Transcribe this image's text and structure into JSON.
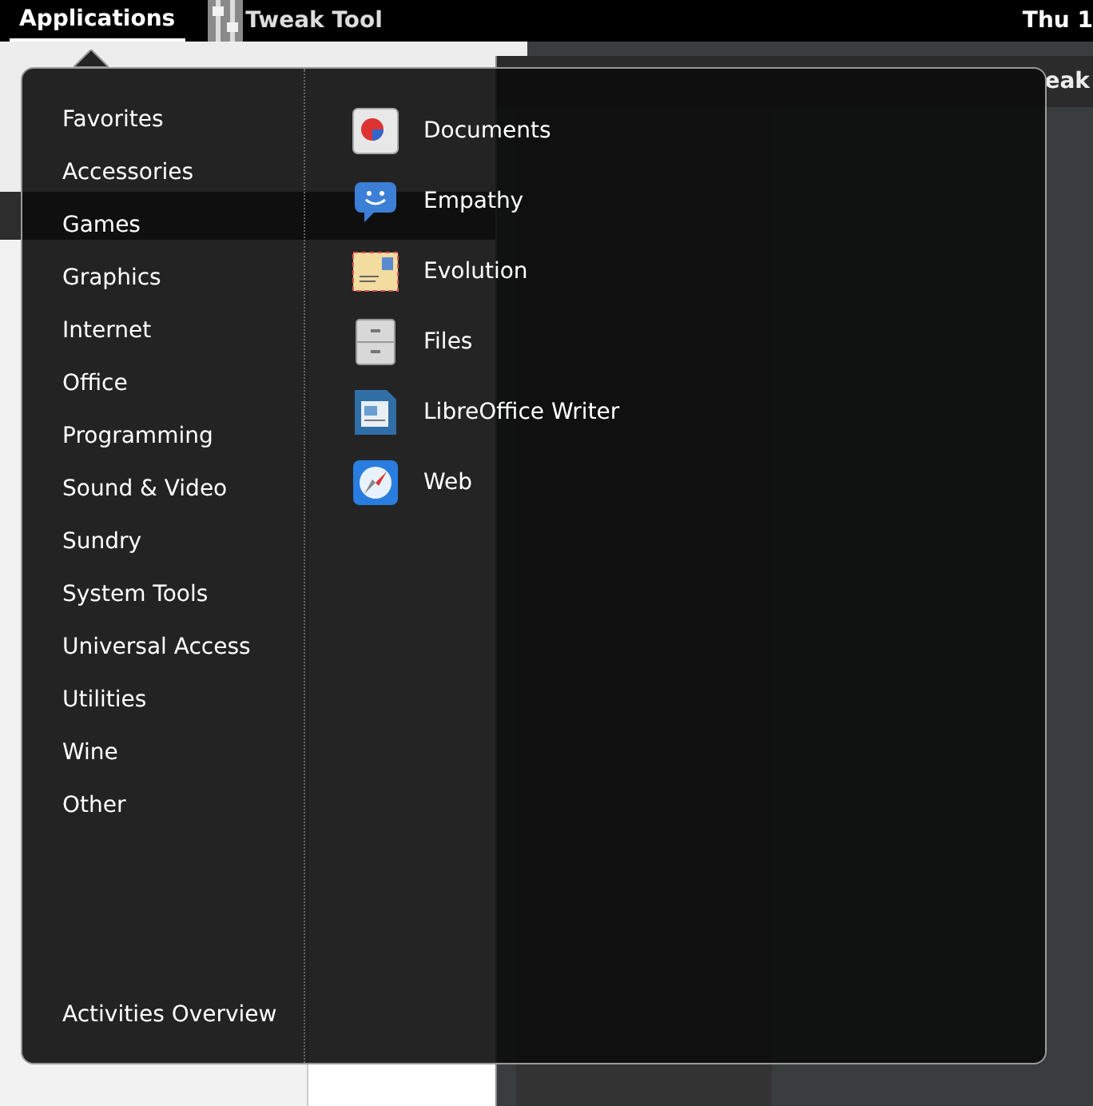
{
  "top_bar": {
    "applications": {
      "label": "Applications",
      "selected": true
    },
    "app_name": "Tweak Tool",
    "clock": "Thu 1"
  },
  "tweak_tool": {
    "title": "eak"
  },
  "menu": {
    "categories": [
      "Favorites",
      "Accessories",
      "Games",
      "Graphics",
      "Internet",
      "Office",
      "Programming",
      "Sound & Video",
      "Sundry",
      "System Tools",
      "Universal Access",
      "Utilities",
      "Wine",
      "Other"
    ],
    "activities": "Activities Overview",
    "apps": [
      "Documents",
      "Empathy",
      "Evolution",
      "Files",
      "LibreOffice Writer",
      "Web"
    ]
  }
}
